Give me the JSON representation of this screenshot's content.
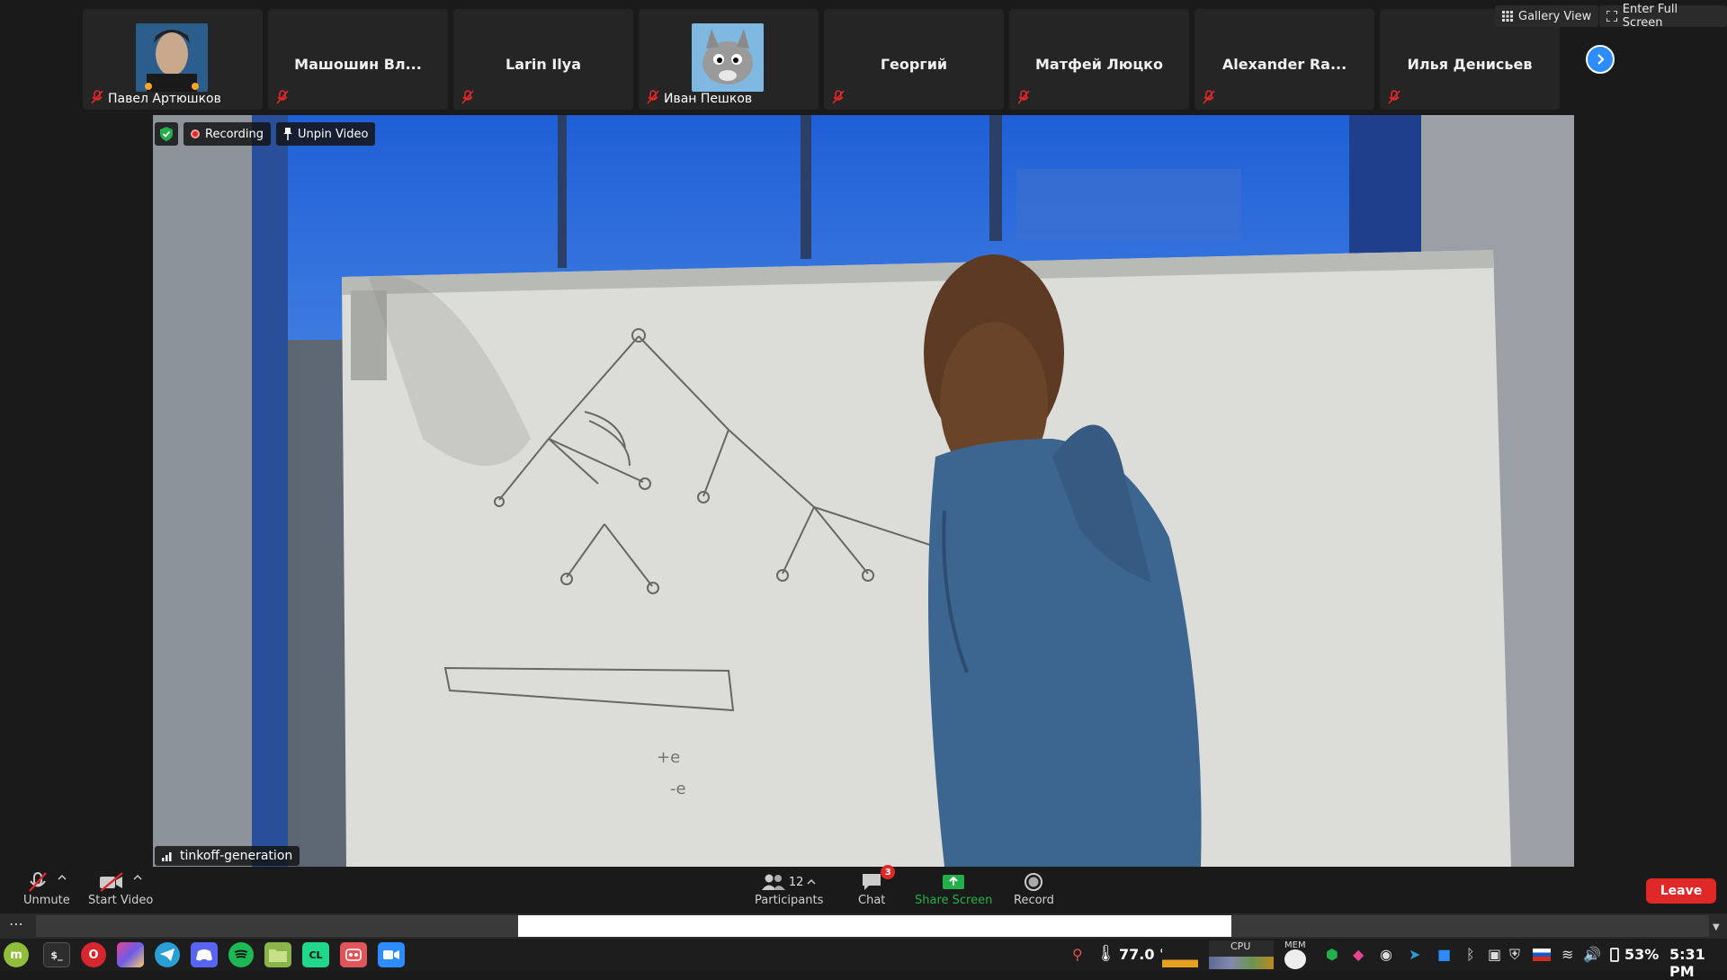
{
  "top_bar": {
    "gallery_view": "Gallery View",
    "enter_full_screen": "Enter Full Screen"
  },
  "participants": [
    {
      "name": "Павел Артюшков",
      "has_avatar": true,
      "avatar": "robot-hero"
    },
    {
      "name": "Машошин Вл...",
      "has_avatar": false
    },
    {
      "name": "Larin Ilya",
      "has_avatar": false
    },
    {
      "name": "Иван Пешков",
      "has_avatar": true,
      "avatar": "wolf"
    },
    {
      "name": "Георгий",
      "has_avatar": false
    },
    {
      "name": "Матфей Люцко",
      "has_avatar": false
    },
    {
      "name": "Alexander Ra...",
      "has_avatar": false
    },
    {
      "name": "Илья Денисьев",
      "has_avatar": false
    }
  ],
  "video": {
    "recording_label": "Recording",
    "unpin_label": "Unpin Video",
    "speaker_name": "tinkoff-generation"
  },
  "toolbar": {
    "unmute": "Unmute",
    "start_video": "Start Video",
    "participants_label": "Participants",
    "participants_count": "12",
    "chat": "Chat",
    "chat_badge": "3",
    "share_screen": "Share Screen",
    "record": "Record",
    "leave": "Leave"
  },
  "taskbar": {
    "temperature": "77.0 °",
    "cpu_label": "CPU",
    "mem_label": "MEM",
    "battery": "53%",
    "time": "5:31 PM"
  },
  "colors": {
    "accent": "#2d8cff",
    "leave": "#e02828",
    "share_green": "#23b04a",
    "muted_red": "#e02828"
  }
}
